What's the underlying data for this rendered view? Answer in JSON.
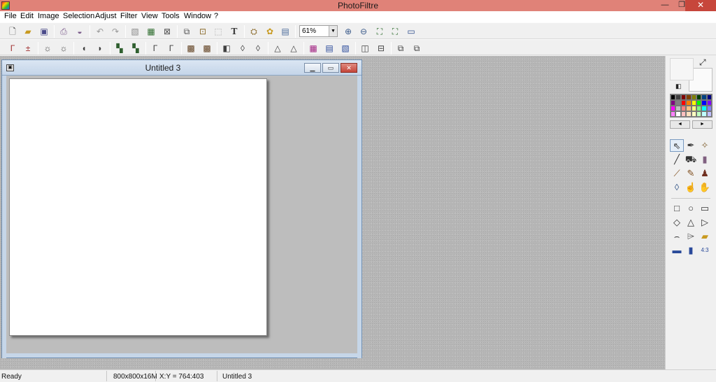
{
  "app": {
    "title": "PhotoFiltre",
    "close_glyph": "✕",
    "min_glyph": "—",
    "max_glyph": "❐"
  },
  "menu": [
    "File",
    "Edit",
    "Image",
    "Selection",
    "Adjust",
    "Filter",
    "View",
    "Tools",
    "Window",
    "?"
  ],
  "toolbar": {
    "zoom_value": "61%",
    "zoom_arrow": "▼"
  },
  "document": {
    "title": "Untitled 3",
    "min_glyph": "▁",
    "max_glyph": "▭",
    "close_glyph": "✕"
  },
  "palette": {
    "colors": [
      "#000000",
      "#404040",
      "#800000",
      "#804000",
      "#808000",
      "#004000",
      "#004080",
      "#000080",
      "#800080",
      "#808080",
      "#ff0000",
      "#ff8000",
      "#ffff00",
      "#00ff00",
      "#0000ff",
      "#8000ff",
      "#ff00ff",
      "#c0c0c0",
      "#ff8080",
      "#ffc080",
      "#ffff80",
      "#80ff80",
      "#00ffff",
      "#8080ff",
      "#ff80ff",
      "#ffffff",
      "#ffc0c0",
      "#ffe0c0",
      "#ffffc0",
      "#c0ffc0",
      "#c0ffff",
      "#c0c0ff"
    ],
    "prev_glyph": "◄",
    "next_glyph": "►"
  },
  "colors": {
    "foreground": "#f6f6f6",
    "background": "#fafafa"
  },
  "status": {
    "state": "Ready",
    "image_size": "800x800x16M",
    "coords": "X:Y = 764:403",
    "doc_name": "Untitled 3"
  }
}
